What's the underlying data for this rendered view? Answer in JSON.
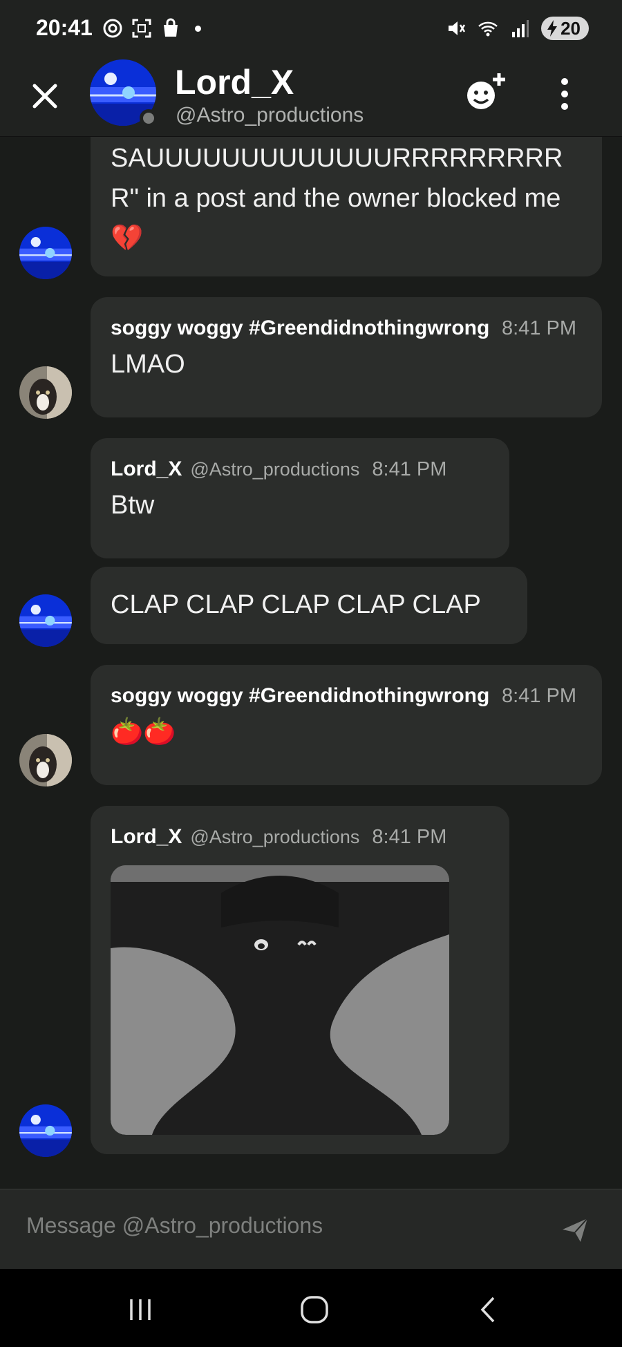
{
  "status": {
    "time": "20:41",
    "battery": "20"
  },
  "header": {
    "name": "Lord_X",
    "handle": "@Astro_productions"
  },
  "messages": [
    {
      "text": "SAUUUUUUUUUUUUURRRRRRRRRR\" in a post and the owner blocked me💔"
    },
    {
      "author": "soggy woggy #Greendidnothingwrong",
      "time": "8:41 PM",
      "text": "LMAO"
    },
    {
      "author": "Lord_X",
      "handle": "@Astro_productions",
      "time": "8:41 PM",
      "text": "Btw"
    },
    {
      "text": "CLAP CLAP CLAP CLAP CLAP"
    },
    {
      "author": "soggy woggy #Greendidnothingwrong",
      "time": "8:41 PM",
      "text": "🍅🍅"
    },
    {
      "author": "Lord_X",
      "handle": "@Astro_productions",
      "time": "8:41 PM"
    }
  ],
  "composer": {
    "placeholder": "Message @Astro_productions"
  },
  "icons": {
    "close": "close-icon",
    "add_friend": "add-friend-icon",
    "more": "more-vertical-icon",
    "send": "send-icon",
    "recents": "recents-icon",
    "home": "home-icon",
    "back": "back-icon"
  },
  "colors": {
    "bubble": "#2b2d2b",
    "background": "#1a1c1a",
    "header": "#202220"
  }
}
